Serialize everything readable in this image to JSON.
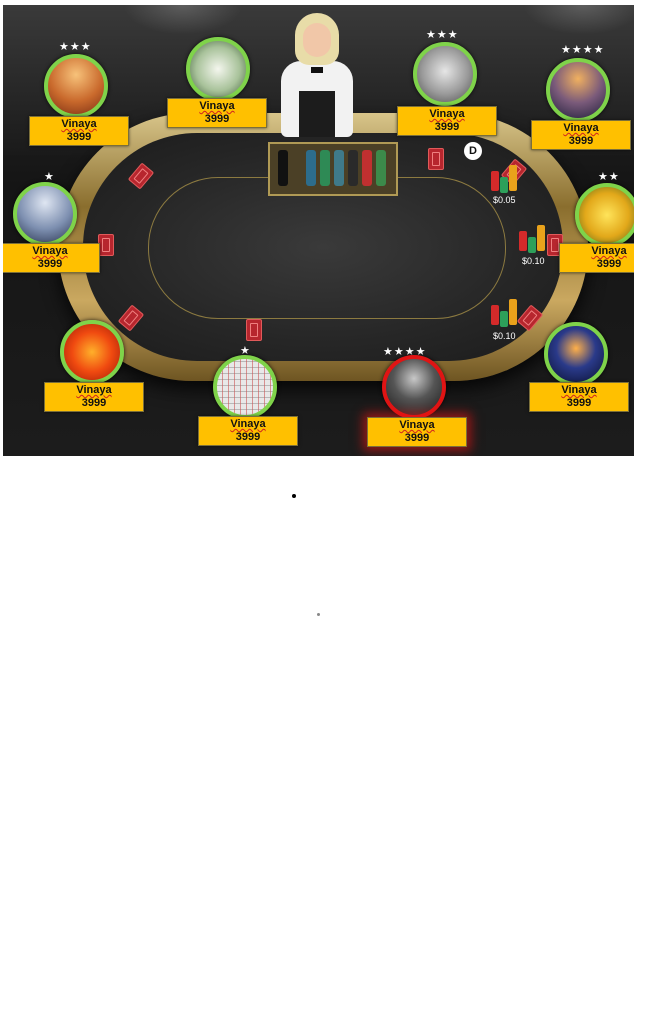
{
  "player_name": "Vinaya",
  "player_chips": "3999",
  "dealer_button_label": "D",
  "bets": [
    "$0.05",
    "$0.10",
    "$0.10"
  ],
  "colors": {
    "seat_ring": "#7fd34a",
    "active_ring": "#e01414",
    "nameplate": "#ffc000",
    "card_back": "#b7262e"
  },
  "seats": [
    {
      "id": "top-left-1",
      "avatar": "canyon-photo",
      "stars": "★★★",
      "active": false
    },
    {
      "id": "top-left-2",
      "avatar": "white-flowers-photo",
      "stars": "",
      "active": false
    },
    {
      "id": "top-center",
      "avatar": "koala-photo",
      "stars": "★★★",
      "active": false
    },
    {
      "id": "top-right",
      "avatar": "lighthouse-photo",
      "stars": "★★★★",
      "active": false
    },
    {
      "id": "left",
      "avatar": "penguins-photo",
      "stars": "★",
      "active": false
    },
    {
      "id": "right",
      "avatar": "tulips-photo",
      "stars": "★★",
      "active": false
    },
    {
      "id": "bottom-left",
      "avatar": "red-flower-photo",
      "stars": "",
      "active": false
    },
    {
      "id": "bottom-center-left",
      "avatar": "grid-image",
      "stars": "★",
      "active": false
    },
    {
      "id": "bottom-center-right",
      "avatar": "woman-photo",
      "stars": "★★★★",
      "active": true
    },
    {
      "id": "bottom-right",
      "avatar": "jellyfish-photo",
      "stars": "",
      "active": false
    }
  ]
}
